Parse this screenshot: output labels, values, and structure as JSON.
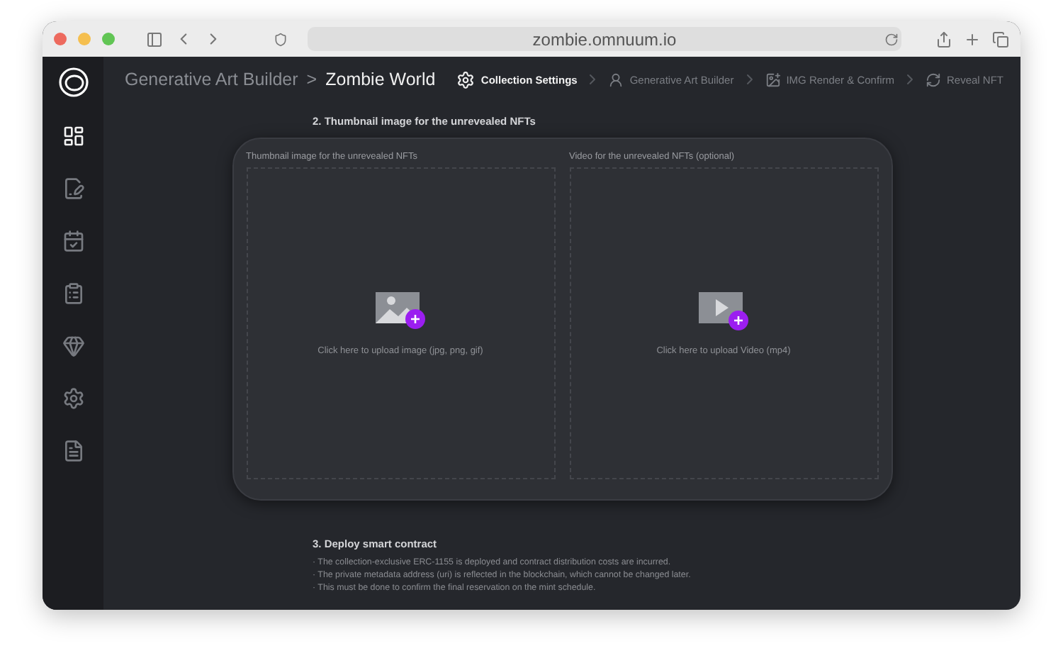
{
  "browser": {
    "url": "zombie.omnuum.io"
  },
  "sidebar": {
    "items": [
      {
        "kind": "dashboard",
        "selected": true
      },
      {
        "kind": "edit",
        "selected": false
      },
      {
        "kind": "calendar",
        "selected": false
      },
      {
        "kind": "clipboard",
        "selected": false
      },
      {
        "kind": "ethereum",
        "selected": false
      },
      {
        "kind": "settings",
        "selected": false
      },
      {
        "kind": "document",
        "selected": false
      }
    ]
  },
  "breadcrumb": {
    "parent": "Generative Art Builder",
    "separator": ">",
    "current": "Zombie World"
  },
  "steps": [
    {
      "kind": "settings",
      "label": "Collection Settings",
      "selected": true
    },
    {
      "kind": "person",
      "label": "Generative Art Builder",
      "selected": false
    },
    {
      "kind": "render",
      "label": "IMG Render & Confirm",
      "selected": false
    },
    {
      "kind": "reveal",
      "label": "Reveal NFT",
      "selected": false
    }
  ],
  "thumbnail_section": {
    "title": "2. Thumbnail image for the unrevealed NFTs",
    "uploads": [
      {
        "kind": "image",
        "label": "Thumbnail image for the unrevealed NFTs",
        "hint": "Click here to upload image (jpg, png, gif)"
      },
      {
        "kind": "video",
        "label": "Video for the unrevealed NFTs (optional)",
        "hint": "Click here to upload Video (mp4)"
      }
    ]
  },
  "deploy_section": {
    "title": "3. Deploy smart contract",
    "notes": [
      "· The collection-exclusive ERC-1155 is deployed and contract distribution costs are incurred.",
      "· The private metadata address (uri) is reflected in the blockchain, which cannot be changed later.",
      "· This must be done to confirm the final reservation on the mint schedule."
    ]
  }
}
